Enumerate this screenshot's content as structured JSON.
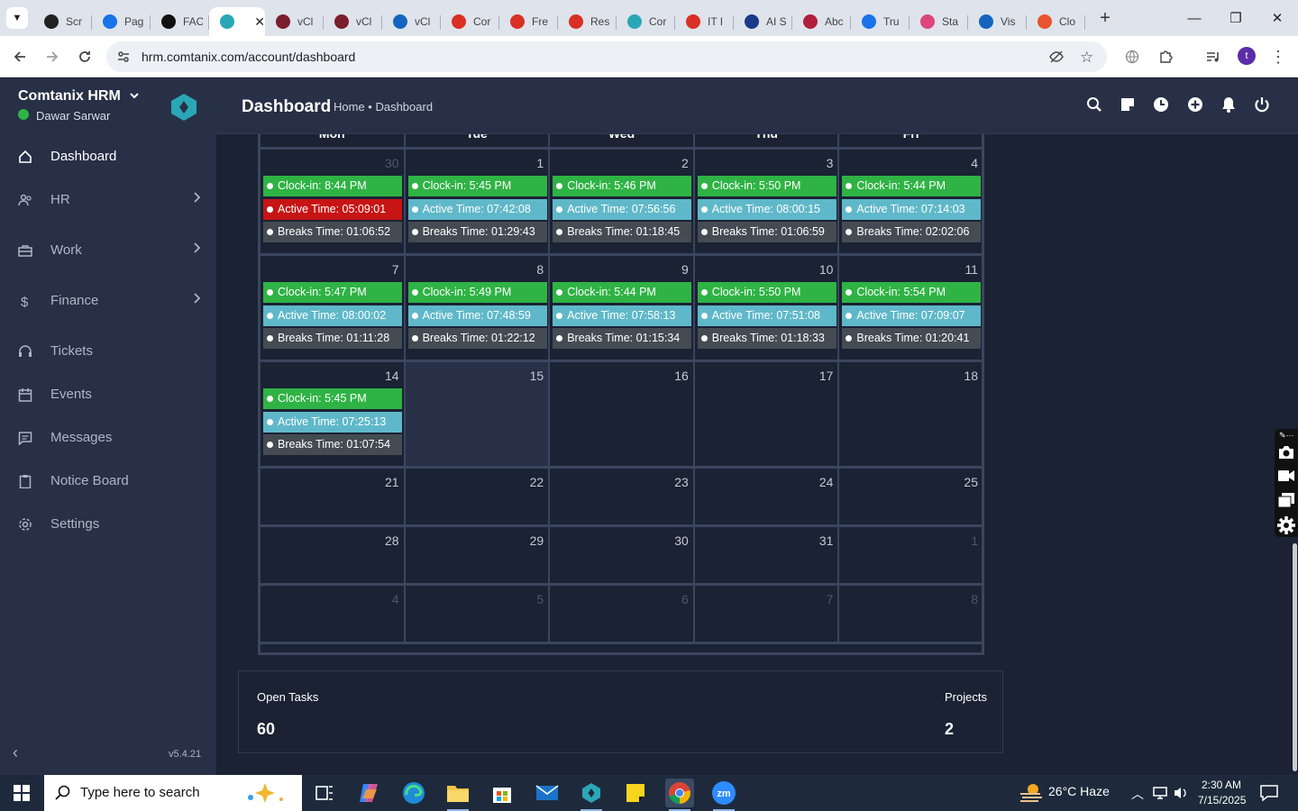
{
  "browser": {
    "tabs": [
      {
        "label": "Scr",
        "color": "#222222"
      },
      {
        "label": "Pag",
        "color": "#1a73e8"
      },
      {
        "label": "FAC",
        "color": "#111111"
      },
      {
        "label": "",
        "color": "#2aa7b6",
        "active": true
      },
      {
        "label": "vCl",
        "color": "#7a1f2b"
      },
      {
        "label": "vCl",
        "color": "#7a1f2b"
      },
      {
        "label": "vCl",
        "color": "#1565c0"
      },
      {
        "label": "Cor",
        "color": "#d93025"
      },
      {
        "label": "Fre",
        "color": "#d93025"
      },
      {
        "label": "Res",
        "color": "#d93025"
      },
      {
        "label": "Cor",
        "color": "#2aa7b6"
      },
      {
        "label": "IT I",
        "color": "#d93025"
      },
      {
        "label": "AI S",
        "color": "#1b3a8a"
      },
      {
        "label": "Abc",
        "color": "#b0203c"
      },
      {
        "label": "Tru",
        "color": "#1a73e8"
      },
      {
        "label": "Sta",
        "color": "#e0457b"
      },
      {
        "label": "Vis",
        "color": "#1565c0"
      },
      {
        "label": "Clo",
        "color": "#e8542f"
      }
    ],
    "close_glyph": "✕",
    "new_tab_glyph": "+",
    "url": "hrm.comtanix.com/account/dashboard",
    "profile_initial": "t"
  },
  "app": {
    "brand": "Comtanix HRM",
    "user": "Dawar Sarwar",
    "version": "v5.4.21",
    "page_title": "Dashboard",
    "breadcrumb": "Home • Dashboard",
    "nav": [
      {
        "label": "Dashboard",
        "icon": "home-icon",
        "active": true,
        "chevron": false
      },
      {
        "label": "HR",
        "icon": "users-icon",
        "chevron": true
      },
      {
        "label": "Work",
        "icon": "briefcase-icon",
        "chevron": true
      },
      {
        "label": "Finance",
        "icon": "dollar-icon",
        "chevron": true
      },
      {
        "label": "Tickets",
        "icon": "headset-icon",
        "chevron": false
      },
      {
        "label": "Events",
        "icon": "calendar-icon",
        "chevron": false
      },
      {
        "label": "Messages",
        "icon": "message-icon",
        "chevron": false
      },
      {
        "label": "Notice Board",
        "icon": "clipboard-icon",
        "chevron": false
      },
      {
        "label": "Settings",
        "icon": "gear-icon",
        "chevron": false
      }
    ],
    "header_icons": [
      "search-icon",
      "note-icon",
      "clock-icon",
      "plus-circle-icon",
      "bell-icon",
      "power-icon"
    ]
  },
  "calendar": {
    "weekdays": [
      "Mon",
      "Tue",
      "Wed",
      "Thu",
      "Fri"
    ],
    "weeks": [
      [
        {
          "day": "30",
          "muted": true,
          "events": [
            [
              "green",
              "Clock-in: 8:44 PM"
            ],
            [
              "red",
              "Active Time: 05:09:01"
            ],
            [
              "dark",
              "Breaks Time: 01:06:52"
            ]
          ]
        },
        {
          "day": "1",
          "events": [
            [
              "green",
              "Clock-in: 5:45 PM"
            ],
            [
              "teal",
              "Active Time: 07:42:08"
            ],
            [
              "dark",
              "Breaks Time: 01:29:43"
            ]
          ]
        },
        {
          "day": "2",
          "events": [
            [
              "green",
              "Clock-in: 5:46 PM"
            ],
            [
              "teal",
              "Active Time: 07:56:56"
            ],
            [
              "dark",
              "Breaks Time: 01:18:45"
            ]
          ]
        },
        {
          "day": "3",
          "events": [
            [
              "green",
              "Clock-in: 5:50 PM"
            ],
            [
              "teal",
              "Active Time: 08:00:15"
            ],
            [
              "dark",
              "Breaks Time: 01:06:59"
            ]
          ]
        },
        {
          "day": "4",
          "events": [
            [
              "green",
              "Clock-in: 5:44 PM"
            ],
            [
              "teal",
              "Active Time: 07:14:03"
            ],
            [
              "dark",
              "Breaks Time: 02:02:06"
            ]
          ]
        }
      ],
      [
        {
          "day": "7",
          "events": [
            [
              "green",
              "Clock-in: 5:47 PM"
            ],
            [
              "teal",
              "Active Time: 08:00:02"
            ],
            [
              "dark",
              "Breaks Time: 01:11:28"
            ]
          ]
        },
        {
          "day": "8",
          "events": [
            [
              "green",
              "Clock-in: 5:49 PM"
            ],
            [
              "teal",
              "Active Time: 07:48:59"
            ],
            [
              "dark",
              "Breaks Time: 01:22:12"
            ]
          ]
        },
        {
          "day": "9",
          "events": [
            [
              "green",
              "Clock-in: 5:44 PM"
            ],
            [
              "teal",
              "Active Time: 07:58:13"
            ],
            [
              "dark",
              "Breaks Time: 01:15:34"
            ]
          ]
        },
        {
          "day": "10",
          "events": [
            [
              "green",
              "Clock-in: 5:50 PM"
            ],
            [
              "teal",
              "Active Time: 07:51:08"
            ],
            [
              "dark",
              "Breaks Time: 01:18:33"
            ]
          ]
        },
        {
          "day": "11",
          "events": [
            [
              "green",
              "Clock-in: 5:54 PM"
            ],
            [
              "teal",
              "Active Time: 07:09:07"
            ],
            [
              "dark",
              "Breaks Time: 01:20:41"
            ]
          ]
        }
      ],
      [
        {
          "day": "14",
          "events": [
            [
              "green",
              "Clock-in: 5:45 PM"
            ],
            [
              "teal",
              "Active Time: 07:25:13"
            ],
            [
              "dark",
              "Breaks Time: 01:07:54"
            ]
          ]
        },
        {
          "day": "15",
          "today": true,
          "events": []
        },
        {
          "day": "16",
          "events": []
        },
        {
          "day": "17",
          "events": []
        },
        {
          "day": "18",
          "events": []
        }
      ],
      [
        {
          "day": "21",
          "events": []
        },
        {
          "day": "22",
          "events": []
        },
        {
          "day": "23",
          "events": []
        },
        {
          "day": "24",
          "events": []
        },
        {
          "day": "25",
          "events": []
        }
      ],
      [
        {
          "day": "28",
          "events": []
        },
        {
          "day": "29",
          "events": []
        },
        {
          "day": "30",
          "events": []
        },
        {
          "day": "31",
          "events": []
        },
        {
          "day": "1",
          "muted": true,
          "events": []
        }
      ],
      [
        {
          "day": "4",
          "muted": true,
          "events": []
        },
        {
          "day": "5",
          "muted": true,
          "events": []
        },
        {
          "day": "6",
          "muted": true,
          "events": []
        },
        {
          "day": "7",
          "muted": true,
          "events": []
        },
        {
          "day": "8",
          "muted": true,
          "events": []
        }
      ]
    ]
  },
  "stats": {
    "open_tasks_label": "Open Tasks",
    "open_tasks_value": "60",
    "projects_label": "Projects",
    "projects_value": "2"
  },
  "taskbar": {
    "search_placeholder": "Type here to search",
    "weather": "26°C  Haze",
    "time": "2:30 AM",
    "date": "7/15/2025"
  }
}
